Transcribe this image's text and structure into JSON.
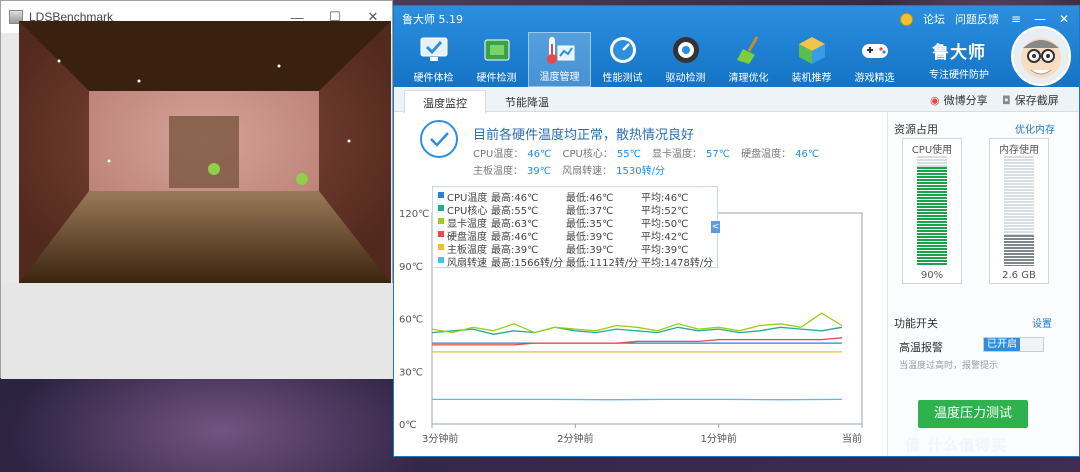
{
  "bench": {
    "title": "LDSBenchmark",
    "controls": {
      "minimize": "—",
      "maximize": "☐",
      "close": "✕"
    }
  },
  "master": {
    "app_title": "鲁大师 5.19",
    "top_links": {
      "forum": "论坛",
      "feedback": "问题反馈"
    },
    "nav": [
      {
        "label": "硬件体检",
        "icon": "monitor-check-icon"
      },
      {
        "label": "硬件检测",
        "icon": "circuit-board-icon"
      },
      {
        "label": "温度管理",
        "icon": "thermometer-chart-icon"
      },
      {
        "label": "性能测试",
        "icon": "speedometer-icon"
      },
      {
        "label": "驱动检测",
        "icon": "gear-cube-icon"
      },
      {
        "label": "清理优化",
        "icon": "broom-icon"
      },
      {
        "label": "装机推荐",
        "icon": "cube-icon"
      },
      {
        "label": "游戏精选",
        "icon": "gamepad-icon"
      }
    ],
    "active_nav": "温度管理",
    "brand": {
      "name": "鲁大师",
      "slogan": "专注硬件防护"
    }
  },
  "tabs": [
    {
      "label": "温度监控",
      "active": true
    },
    {
      "label": "节能降温",
      "active": false
    }
  ],
  "share": {
    "weibo": "微博分享",
    "screenshot": "保存截屏"
  },
  "status": {
    "headline": "目前各硬件温度均正常，散热情况良好",
    "row1": [
      {
        "label": "CPU温度：",
        "value": "46℃"
      },
      {
        "label": "CPU核心：",
        "value": "55℃"
      },
      {
        "label": "显卡温度：",
        "value": "57℃"
      },
      {
        "label": "硬盘温度：",
        "value": "46℃"
      }
    ],
    "row2": [
      {
        "label": "主板温度：",
        "value": "39℃"
      },
      {
        "label": "风扇转速：",
        "value": "1530转/分"
      }
    ]
  },
  "legend": [
    {
      "name": "CPU温度",
      "max": "最高:46℃",
      "min": "最低:46℃",
      "avg": "平均:46℃",
      "color": "#2d7fd8"
    },
    {
      "name": "CPU核心",
      "max": "最高:55℃",
      "min": "最低:37℃",
      "avg": "平均:52℃",
      "color": "#1fae8f"
    },
    {
      "name": "显卡温度",
      "max": "最高:63℃",
      "min": "最低:35℃",
      "avg": "平均:50℃",
      "color": "#9ccc1c"
    },
    {
      "name": "硬盘温度",
      "max": "最高:46℃",
      "min": "最低:39℃",
      "avg": "平均:42℃",
      "color": "#e84848"
    },
    {
      "name": "主板温度",
      "max": "最高:39℃",
      "min": "最低:39℃",
      "avg": "平均:39℃",
      "color": "#f0bf2a"
    },
    {
      "name": "风扇转速",
      "max": "最高:1566转/分",
      "min": "最低:1112转/分",
      "avg": "平均:1478转/分",
      "color": "#49c2e8"
    }
  ],
  "legend_toggle": "<",
  "chart_data": {
    "type": "line",
    "y_ticks": [
      "120℃",
      "90℃",
      "60℃",
      "30℃",
      "0℃"
    ],
    "ylim": [
      0,
      120
    ],
    "x_ticks": [
      "3分钟前",
      "2分钟前",
      "1分钟前",
      "当前"
    ],
    "series": [
      {
        "name": "CPU温度",
        "color": "#2d7fd8",
        "values": [
          46,
          46,
          46,
          46,
          46,
          46,
          46,
          46
        ]
      },
      {
        "name": "CPU核心",
        "color": "#1fae8f",
        "values": [
          52,
          53,
          54,
          51,
          53,
          52,
          55,
          53,
          52,
          54,
          53,
          52,
          55,
          53,
          54,
          52,
          53,
          55,
          54,
          53,
          55
        ]
      },
      {
        "name": "显卡温度",
        "color": "#9ccc1c",
        "values": [
          54,
          52,
          55,
          53,
          57,
          52,
          55,
          54,
          53,
          56,
          55,
          53,
          57,
          54,
          55,
          53,
          56,
          57,
          55,
          63,
          56
        ]
      },
      {
        "name": "硬盘温度",
        "color": "#e84848",
        "values": [
          45,
          45,
          45,
          45,
          45,
          46,
          46,
          46,
          46,
          46,
          47,
          47,
          47,
          47,
          48,
          48,
          48,
          48,
          48,
          48,
          49
        ]
      },
      {
        "name": "主板温度",
        "color": "#f0bf2a",
        "values": [
          41,
          41,
          41,
          41,
          41,
          41,
          41,
          41
        ]
      },
      {
        "name": "风扇转速",
        "color": "#49c2e8",
        "values": [
          14,
          14,
          14,
          13.8,
          14,
          14,
          13.8,
          14
        ]
      }
    ]
  },
  "sidebar": {
    "resources_title": "资源占用",
    "optimize_link": "优化内存",
    "cpu": {
      "label": "CPU使用",
      "value": "90%",
      "level": 0.9
    },
    "memory": {
      "label": "内存使用",
      "value": "2.6 GB",
      "level": 0.28
    },
    "switch_title": "功能开关",
    "settings_link": "设置",
    "alarm_label": "高温报警",
    "alarm_state": "已开启",
    "alarm_hint": "当温度过高时，报警提示",
    "stress_button": "温度压力测试"
  },
  "watermark": "值 什么值得买"
}
